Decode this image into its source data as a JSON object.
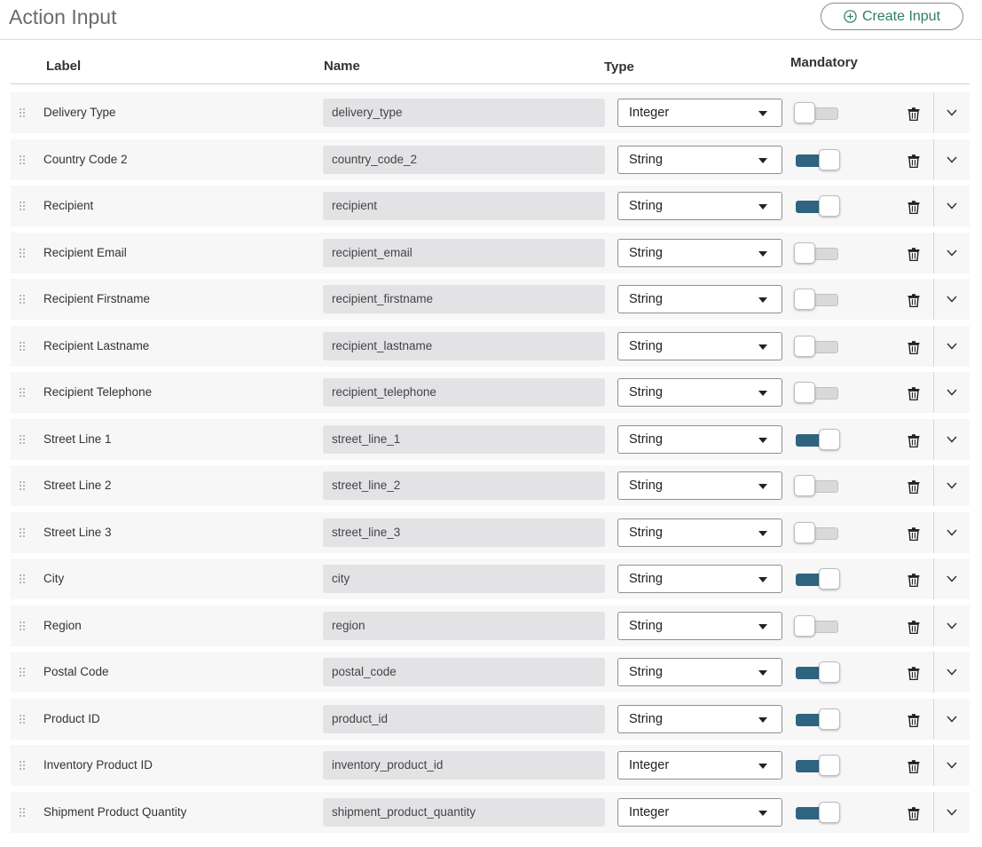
{
  "header": {
    "title": "Action Input",
    "create_label": "Create Input",
    "create_icon": "plus-circle-icon"
  },
  "columns": {
    "label": "Label",
    "name": "Name",
    "type": "Type",
    "mandatory": "Mandatory"
  },
  "colors": {
    "toggle_on": "#2f6480",
    "toggle_off": "#d9d9d9",
    "accent": "#2e7d6b"
  },
  "rows": [
    {
      "label": "Delivery Type",
      "name": "delivery_type",
      "type": "Integer",
      "mandatory": false
    },
    {
      "label": "Country Code 2",
      "name": "country_code_2",
      "type": "String",
      "mandatory": true
    },
    {
      "label": "Recipient",
      "name": "recipient",
      "type": "String",
      "mandatory": true
    },
    {
      "label": "Recipient Email",
      "name": "recipient_email",
      "type": "String",
      "mandatory": false
    },
    {
      "label": "Recipient Firstname",
      "name": "recipient_firstname",
      "type": "String",
      "mandatory": false
    },
    {
      "label": "Recipient Lastname",
      "name": "recipient_lastname",
      "type": "String",
      "mandatory": false
    },
    {
      "label": "Recipient Telephone",
      "name": "recipient_telephone",
      "type": "String",
      "mandatory": false
    },
    {
      "label": "Street Line 1",
      "name": "street_line_1",
      "type": "String",
      "mandatory": true
    },
    {
      "label": "Street Line 2",
      "name": "street_line_2",
      "type": "String",
      "mandatory": false
    },
    {
      "label": "Street Line 3",
      "name": "street_line_3",
      "type": "String",
      "mandatory": false
    },
    {
      "label": "City",
      "name": "city",
      "type": "String",
      "mandatory": true
    },
    {
      "label": "Region",
      "name": "region",
      "type": "String",
      "mandatory": false
    },
    {
      "label": "Postal Code",
      "name": "postal_code",
      "type": "String",
      "mandatory": true
    },
    {
      "label": "Product ID",
      "name": "product_id",
      "type": "String",
      "mandatory": true
    },
    {
      "label": "Inventory Product ID",
      "name": "inventory_product_id",
      "type": "Integer",
      "mandatory": true
    },
    {
      "label": "Shipment Product Quantity",
      "name": "shipment_product_quantity",
      "type": "Integer",
      "mandatory": true
    }
  ]
}
